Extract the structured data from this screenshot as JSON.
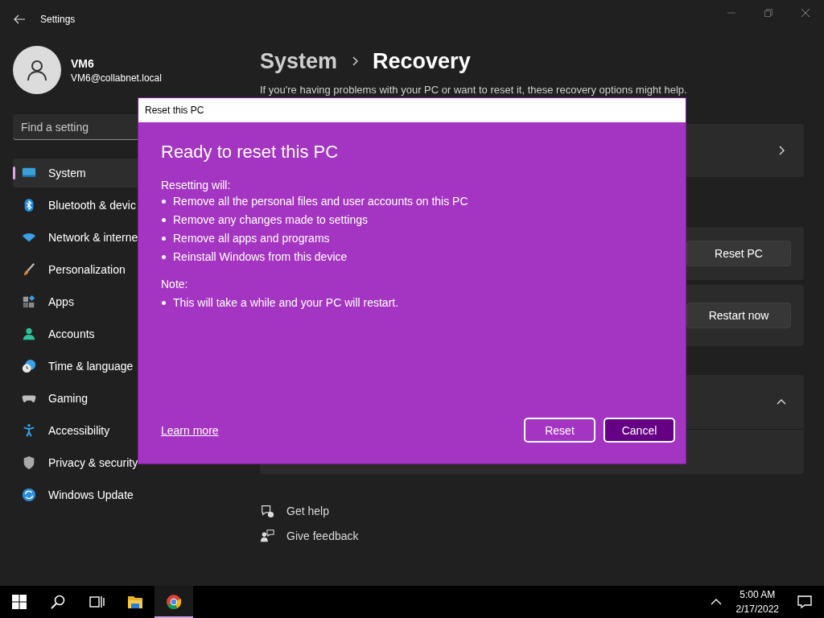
{
  "window": {
    "title": "Settings"
  },
  "user": {
    "name": "VM6",
    "email": "VM6@collabnet.local"
  },
  "search": {
    "placeholder": "Find a setting"
  },
  "sidebar": {
    "items": [
      {
        "label": "System",
        "kind": "system",
        "selected": true
      },
      {
        "label": "Bluetooth & devic",
        "kind": "bluetooth",
        "selected": false
      },
      {
        "label": "Network & interne",
        "kind": "network",
        "selected": false
      },
      {
        "label": "Personalization",
        "kind": "brush",
        "selected": false
      },
      {
        "label": "Apps",
        "kind": "apps",
        "selected": false
      },
      {
        "label": "Accounts",
        "kind": "accounts",
        "selected": false
      },
      {
        "label": "Time & language",
        "kind": "time",
        "selected": false
      },
      {
        "label": "Gaming",
        "kind": "gaming",
        "selected": false
      },
      {
        "label": "Accessibility",
        "kind": "accessibility",
        "selected": false
      },
      {
        "label": "Privacy & security",
        "kind": "privacy",
        "selected": false
      },
      {
        "label": "Windows Update",
        "kind": "update",
        "selected": false
      }
    ]
  },
  "breadcrumb": [
    "System",
    "Recovery"
  ],
  "description": "If you're having problems with your PC or want to reset it, these recovery options might help.",
  "cards": [
    {
      "kind": "link"
    },
    {
      "kind": "button",
      "button": "Reset PC"
    },
    {
      "kind": "button",
      "button": "Restart now"
    },
    {
      "kind": "expander",
      "expanded": true
    }
  ],
  "footer_links": [
    {
      "label": "Get help",
      "kind": "help"
    },
    {
      "label": "Give feedback",
      "kind": "feedback"
    }
  ],
  "dialog": {
    "title": "Reset this PC",
    "heading": "Ready to reset this PC",
    "intro": "Resetting will:",
    "bullets": [
      "Remove all the personal files and user accounts on this PC",
      "Remove any changes made to settings",
      "Remove all apps and programs",
      "Reinstall Windows from this device"
    ],
    "note_label": "Note:",
    "note_bullets": [
      "This will take a while and your PC will restart."
    ],
    "link": "Learn more",
    "buttons": [
      {
        "label": "Reset",
        "default": false
      },
      {
        "label": "Cancel",
        "default": true
      }
    ]
  },
  "taskbar": {
    "items": [
      {
        "kind": "start",
        "active": false
      },
      {
        "kind": "search",
        "active": false
      },
      {
        "kind": "taskview",
        "active": false
      },
      {
        "kind": "explorer",
        "active": false
      },
      {
        "kind": "chrome",
        "active": true
      }
    ],
    "time": "5:00 AM",
    "date": "2/17/2022"
  }
}
